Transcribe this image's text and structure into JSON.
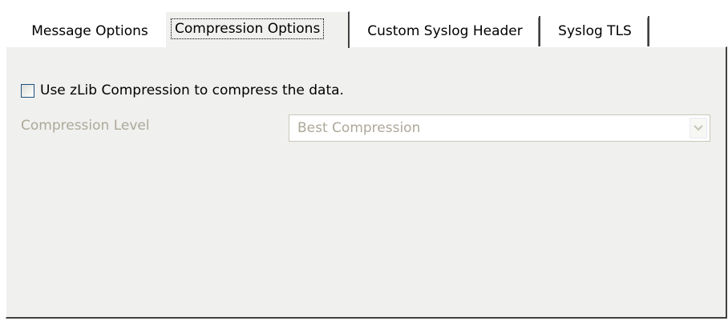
{
  "tabs": [
    {
      "label": "Message Options",
      "active": false
    },
    {
      "label": "Compression Options",
      "active": true
    },
    {
      "label": "Custom Syslog Header",
      "active": false
    },
    {
      "label": "Syslog TLS",
      "active": false
    }
  ],
  "compression": {
    "checkbox_label": "Use zLib Compression to compress the data.",
    "checkbox_checked": false,
    "level_label": "Compression Level",
    "level_value": "Best Compression",
    "level_enabled": false
  },
  "icons": {
    "dropdown": "chevron-down-icon"
  },
  "colors": {
    "panel_bg": "#f0f0ee",
    "disabled_text": "#aca899",
    "checkbox_border": "#1c5180"
  }
}
